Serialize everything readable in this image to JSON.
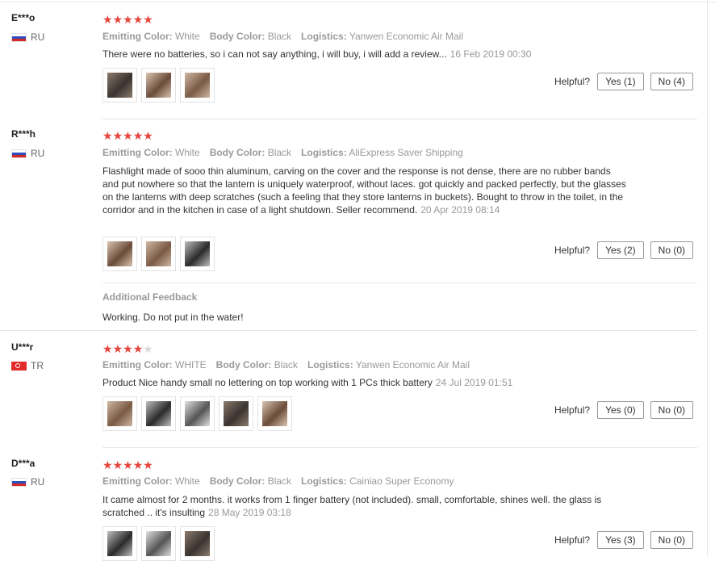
{
  "labels": {
    "emitting_color": "Emitting Color:",
    "body_color": "Body Color:",
    "logistics": "Logistics:",
    "helpful": "Helpful?",
    "additional_feedback": "Additional Feedback"
  },
  "star_colors": {
    "on": "#e6443c",
    "off": "#d9d9d9"
  },
  "reviews": [
    {
      "user": "E***o",
      "country": "RU",
      "rating": 5,
      "emitting_color": "White",
      "body_color": "Black",
      "logistics": "Yanwen Economic Air Mail",
      "text": "There were no batteries, so i can not say anything, i will buy, i will add a review...",
      "date": "16 Feb 2019 00:30",
      "photos": [
        "flashlight-photo",
        "flashlight-photo",
        "flashlight-photo"
      ],
      "yes_label": "Yes (1)",
      "no_label": "No (4)"
    },
    {
      "user": "R***h",
      "country": "RU",
      "rating": 5,
      "emitting_color": "White",
      "body_color": "Black",
      "logistics": "AliExpress Saver Shipping",
      "text": "Flashlight made of sooo thin aluminum, carving on the cover and the response is not dense, there are no rubber bands and put nowhere so that the lantern is uniquely waterproof, without laces. got quickly and packed perfectly, but the glasses on the lanterns with deep scratches (such a feeling that they store lanterns in buckets). Bought to throw in the toilet, in the corridor and in the kitchen in case of a light shutdown. Seller recommend.",
      "date": "20 Apr 2019 08:14",
      "photos": [
        "flashlight-photo",
        "flashlight-photo",
        "flashlight-photo"
      ],
      "yes_label": "Yes (2)",
      "no_label": "No (0)",
      "additional_feedback": "Working. Do not put in the water!"
    },
    {
      "user": "U***r",
      "country": "TR",
      "rating": 4,
      "emitting_color": "WHITE",
      "body_color": "Black",
      "logistics": "Yanwen Economic Air Mail",
      "text": "Product Nice handy small no lettering on top working with 1 PCs thick battery",
      "date": "24 Jul 2019 01:51",
      "photos": [
        "flashlight-photo",
        "flashlight-photo",
        "flashlight-photo",
        "flashlight-photo",
        "flashlight-photo"
      ],
      "yes_label": "Yes (0)",
      "no_label": "No (0)"
    },
    {
      "user": "D***a",
      "country": "RU",
      "rating": 5,
      "emitting_color": "White",
      "body_color": "Black",
      "logistics": "Cainiao Super Economy",
      "text": "It came almost for 2 months. it works from 1 finger battery (not included). small, comfortable, shines well. the glass is scratched .. it's insulting",
      "date": "28 May 2019 03:18",
      "photos": [
        "flashlight-photo",
        "flashlight-photo",
        "flashlight-photo"
      ],
      "yes_label": "Yes (3)",
      "no_label": "No (0)"
    }
  ]
}
